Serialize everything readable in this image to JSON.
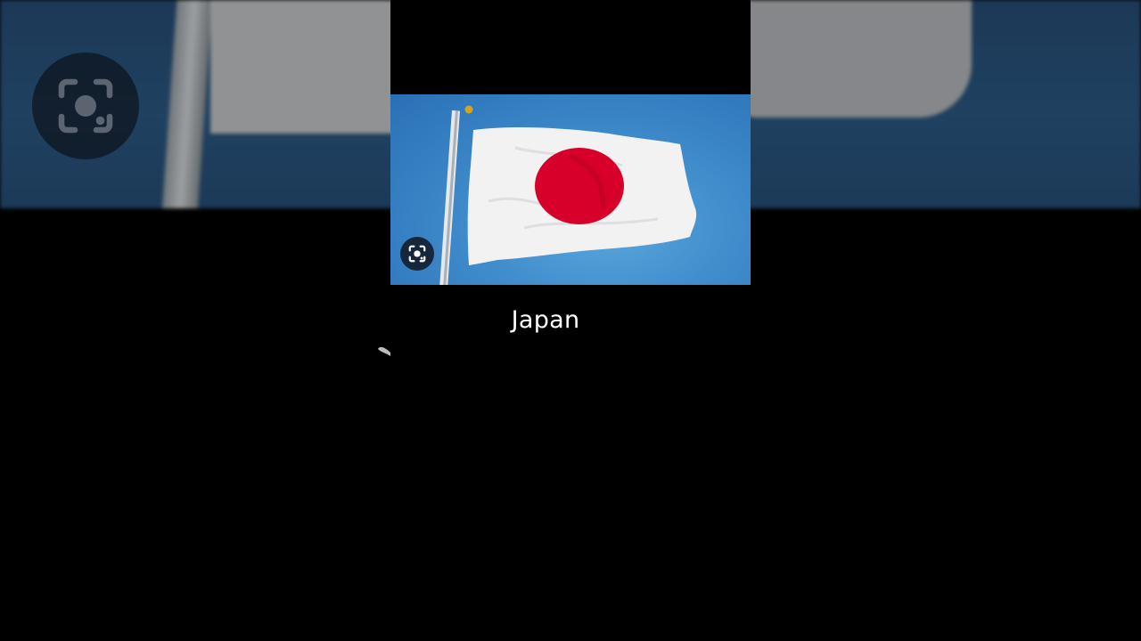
{
  "caption": {
    "text": "Japan"
  },
  "icons": {
    "backdrop_scan": "scan-lens-icon",
    "photo_scan": "scan-lens-icon"
  },
  "colors": {
    "background": "#000000",
    "sky": "#3f8bcb",
    "flag_white": "#f2f2f2",
    "flag_red": "#d7002a"
  }
}
